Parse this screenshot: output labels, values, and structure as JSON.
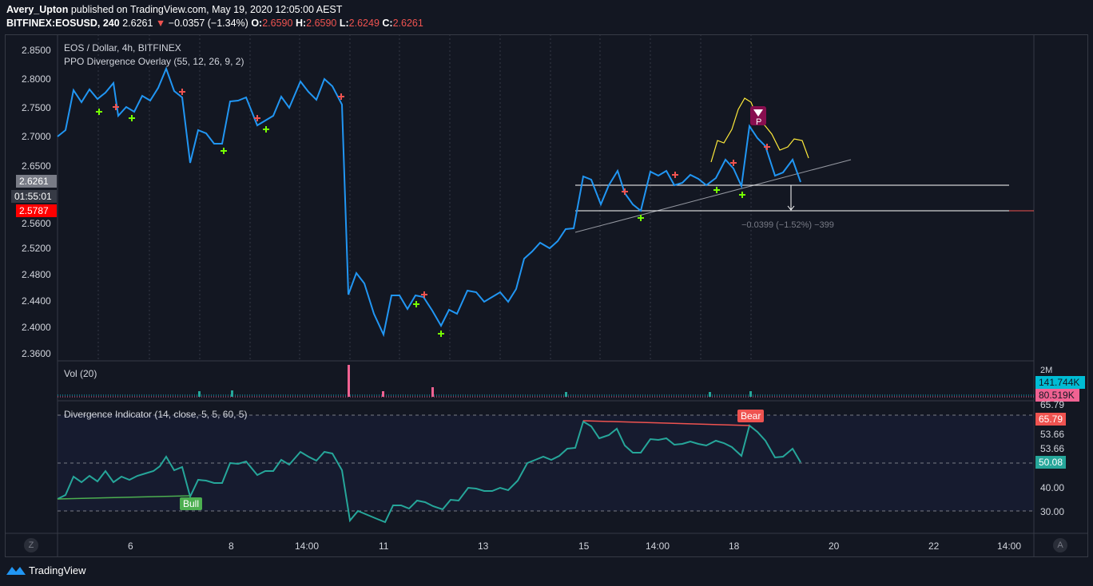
{
  "header": {
    "user": "Avery_Upton",
    "published": "published on TradingView.com, May 19, 2020 12:05:00 AEST",
    "symbol": "BITFINEX:EOSUSD, 240",
    "last": "2.6261",
    "change": "−0.0357 (−1.34%)",
    "o_label": "O:",
    "o": "2.6590",
    "h_label": "H:",
    "h": "2.6590",
    "l_label": "L:",
    "l": "2.6249",
    "c_label": "C:",
    "c": "2.6261"
  },
  "main_pane": {
    "title": "EOS / Dollar, 4h, BITFINEX",
    "overlay": "PPO Divergence Overlay (55, 12, 26, 9, 2)",
    "y_ticks": [
      "2.8500",
      "2.8000",
      "2.7500",
      "2.7000",
      "2.6500",
      "2.5600",
      "2.5200",
      "2.4800",
      "2.4400",
      "2.4000",
      "2.3600"
    ],
    "price_tag": "2.6261",
    "countdown_tag": "01:55:01",
    "red_tag": "2.5787",
    "measure_label": "−0.0399 (−1.52%) −399",
    "p_marker": "P"
  },
  "volume_pane": {
    "title": "Vol (20)",
    "scale_label": "2M",
    "tag1": "141.744K",
    "tag2": "80.519K"
  },
  "indicator_pane": {
    "title": "Divergence Indicator (14, close, 5, 5, 60, 5)",
    "y_ticks": [
      "65.79",
      "53.66",
      "53.66",
      "40.00",
      "30.00"
    ],
    "tag_red": "65.79",
    "tag_green": "50.08",
    "bear_label": "Bear",
    "bull_label": "Bull"
  },
  "x_axis": {
    "labels": [
      "6",
      "8",
      "14:00",
      "11",
      "13",
      "15",
      "14:00",
      "18",
      "20",
      "22",
      "14:00"
    ]
  },
  "footer": {
    "brand": "TradingView",
    "z_button": "Z",
    "a_button": "A"
  },
  "colors": {
    "price_line": "#2196f3",
    "ppo_line": "#ffeb3b",
    "rsi_line": "#26a69a",
    "bear": "#ef5350",
    "bull": "#4caf50",
    "background": "#131722"
  }
}
